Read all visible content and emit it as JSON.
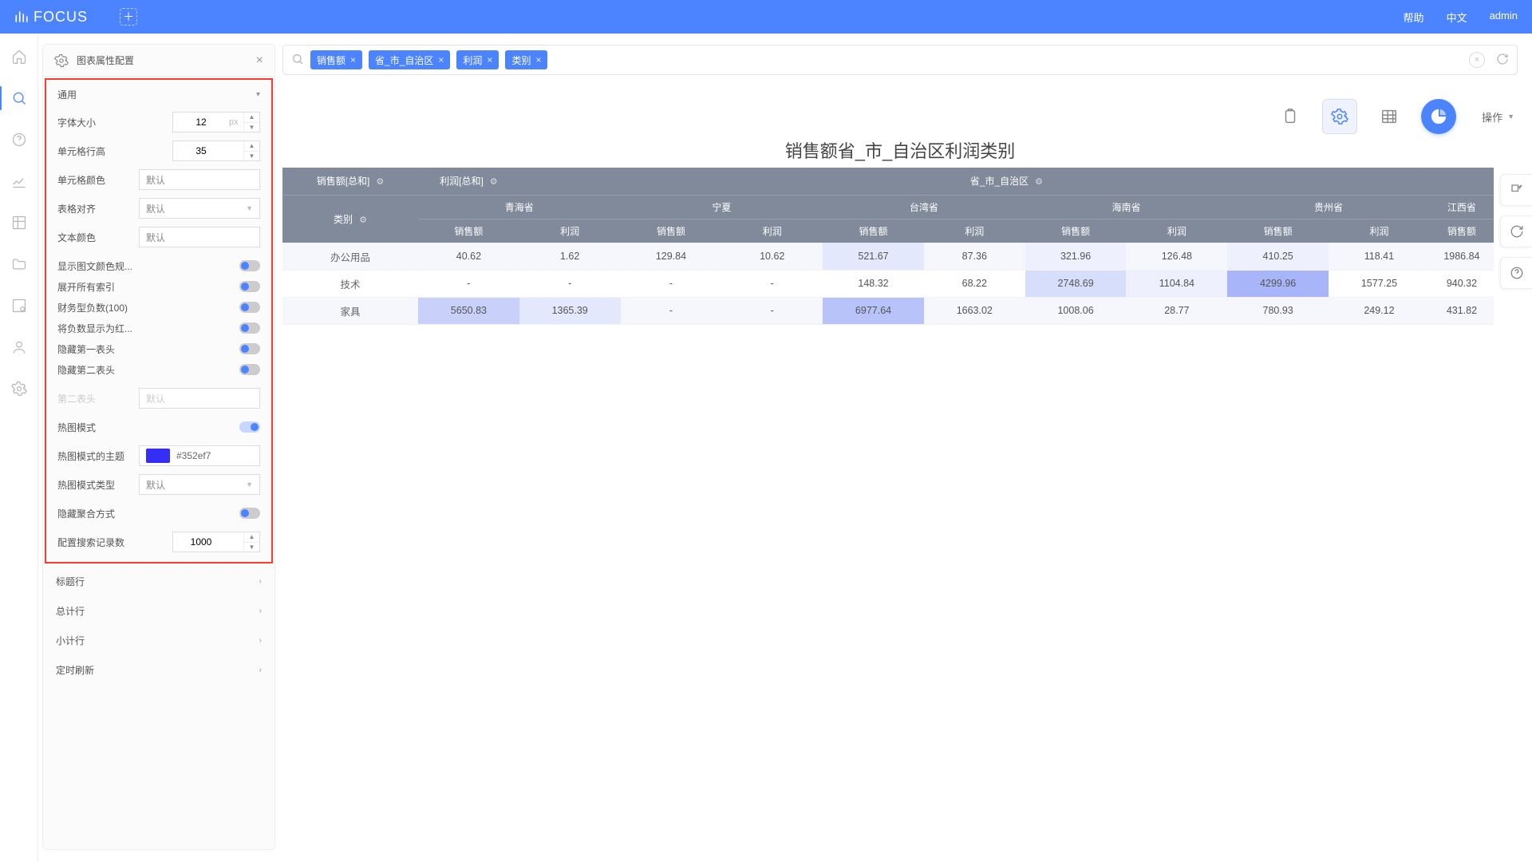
{
  "top": {
    "logo": "FOCUS",
    "help": "帮助",
    "lang": "中文",
    "user": "admin"
  },
  "leftrail": [
    "home",
    "search",
    "help",
    "chart",
    "grid",
    "folder",
    "gear2",
    "user",
    "settings"
  ],
  "panel": {
    "title": "图表属性配置",
    "generic": {
      "name": "通用",
      "font_size_label": "字体大小",
      "font_size": "12",
      "font_unit": "px",
      "row_h_label": "单元格行高",
      "row_h": "35",
      "cell_color_label": "单元格颜色",
      "cell_color_val": "默认",
      "align_label": "表格对齐",
      "align_val": "默认",
      "text_color_label": "文本颜色",
      "text_color_val": "默认",
      "toggles": [
        {
          "label": "显示图文颜色规...",
          "on": false
        },
        {
          "label": "展开所有索引",
          "on": false
        },
        {
          "label": "财务型负数(100)",
          "on": false
        },
        {
          "label": "将负数显示为红...",
          "on": false
        },
        {
          "label": "隐藏第一表头",
          "on": false
        },
        {
          "label": "隐藏第二表头",
          "on": false
        }
      ],
      "second_header_label": "第二表头",
      "second_header_val": "默认",
      "heat_label": "热图模式",
      "heat_on": true,
      "heat_theme_label": "热图模式的主题",
      "heat_theme_hex": "#352ef7",
      "heat_type_label": "热图模式类型",
      "heat_type_val": "默认",
      "hide_agg_label": "隐藏聚合方式",
      "hide_agg_on": false,
      "records_label": "配置搜索记录数",
      "records": "1000"
    },
    "collapsed": [
      "标题行",
      "总计行",
      "小计行",
      "定时刷新"
    ]
  },
  "search": {
    "chips": [
      "销售额",
      "省_市_自治区",
      "利润",
      "类别"
    ]
  },
  "tools": {
    "ops": "操作"
  },
  "title": "销售额省_市_自治区利润类别",
  "table": {
    "m1": "销售额[总和]",
    "m2": "利润[总和]",
    "dim": "省_市_自治区",
    "cat_h": "类别",
    "provinces": [
      "青海省",
      "宁夏",
      "台湾省",
      "海南省",
      "贵州省",
      "江西省"
    ],
    "sub": {
      "s": "销售额",
      "p": "利润"
    },
    "rows": [
      {
        "name": "办公用品",
        "cells": [
          "40.62",
          "1.62",
          "129.84",
          "10.62",
          "521.67",
          "87.36",
          "321.96",
          "126.48",
          "410.25",
          "118.41",
          "1986.84"
        ],
        "cls": [
          "",
          "",
          "",
          "",
          "h4",
          "",
          "last-h",
          "",
          "last-h",
          "",
          ""
        ]
      },
      {
        "name": "技术",
        "cells": [
          "-",
          "-",
          "-",
          "-",
          "148.32",
          "68.22",
          "2748.69",
          "1104.84",
          "4299.96",
          "1577.25",
          "940.32"
        ],
        "cls": [
          "",
          "",
          "",
          "",
          "",
          "",
          "h5",
          "last-h",
          "h3",
          "",
          ""
        ]
      },
      {
        "name": "家具",
        "cells": [
          "5650.83",
          "1365.39",
          "-",
          "-",
          "6977.64",
          "1663.02",
          "1008.06",
          "28.77",
          "780.93",
          "249.12",
          "431.82"
        ],
        "cls": [
          "h1",
          "h4",
          "",
          "",
          "h2",
          "",
          "",
          "",
          "",
          "",
          ""
        ]
      }
    ]
  }
}
